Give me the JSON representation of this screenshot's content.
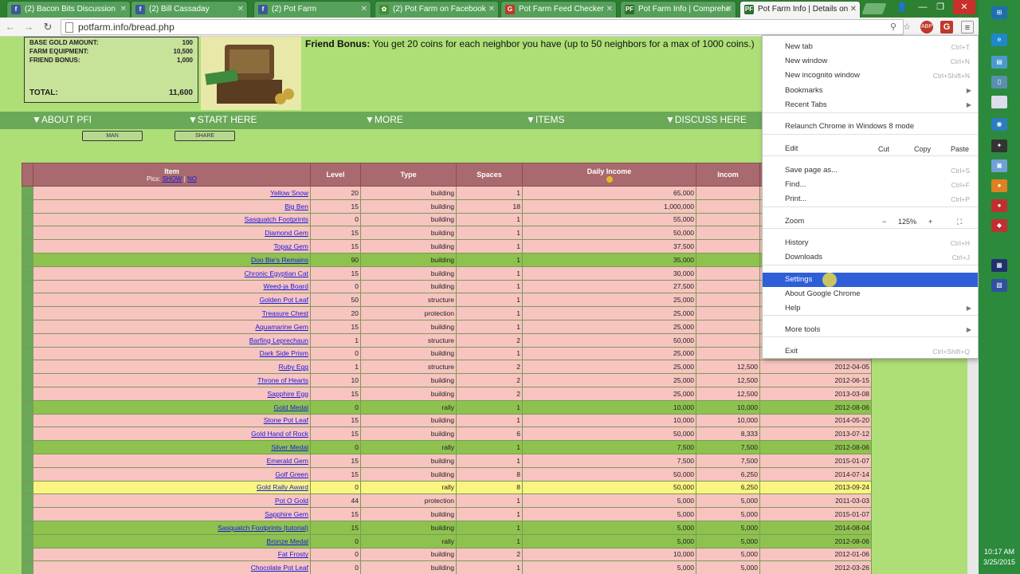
{
  "tabs": [
    {
      "label": "(2) Bacon Bits Discussion",
      "icon": "facebook-icon",
      "color": "#3b5998",
      "glyph": "f"
    },
    {
      "label": "(2) Bill Cassaday",
      "icon": "facebook-icon",
      "color": "#3b5998",
      "glyph": "f"
    },
    {
      "label": "(2) Pot Farm",
      "icon": "facebook-icon",
      "color": "#3b5998",
      "glyph": "f"
    },
    {
      "label": "(2) Pot Farm on Facebook",
      "icon": "leaf-icon",
      "color": "#3f8f2f",
      "glyph": "✿"
    },
    {
      "label": "Pot Farm Feed Checker",
      "icon": "g-icon",
      "color": "#c0392b",
      "glyph": "G"
    },
    {
      "label": "Pot Farm Info | Comprehe",
      "icon": "pf-icon",
      "color": "#2d6e2d",
      "glyph": "PF"
    },
    {
      "label": "Pot Farm Info | Details on",
      "icon": "pf-icon",
      "color": "#2d6e2d",
      "glyph": "PF",
      "active": true
    }
  ],
  "url": "potfarm.info/bread.php",
  "summary": {
    "rows": [
      {
        "label": "BASE GOLD AMOUNT:",
        "value": "100"
      },
      {
        "label": "FARM EQUIPMENT:",
        "value": "10,500"
      },
      {
        "label": "FRIEND BONUS:",
        "value": "1,000"
      }
    ],
    "total_label": "TOTAL:",
    "total_value": "11,600"
  },
  "bonus": {
    "label": "Friend Bonus:",
    "text": " You get 20 coins for each neighbor you have (up to 50 neighbors for a max of 1000 coins.)"
  },
  "nav": [
    "▼ABOUT PFI",
    "▼START HERE",
    "▼MORE",
    "▼ITEMS",
    "▼DISCUSS HERE"
  ],
  "mini_buttons": [
    "MAN",
    "SHARE"
  ],
  "table": {
    "headers": {
      "item": "Item",
      "pics": "Pics:",
      "show": "SHOW",
      "no": "NO",
      "level": "Level",
      "type": "Type",
      "spaces": "Spaces",
      "daily": "Daily Income",
      "income": "Incom"
    },
    "rows": [
      {
        "item": "Yellow Snow",
        "level": "20",
        "type": "building",
        "spaces": "1",
        "daily": "65,000",
        "inc": "",
        "date": "",
        "color": "pink"
      },
      {
        "item": "Big Ben",
        "level": "15",
        "type": "building",
        "spaces": "18",
        "daily": "1,000,000",
        "inc": "",
        "date": "",
        "color": "pink"
      },
      {
        "item": "Sasquatch Footprints",
        "level": "0",
        "type": "building",
        "spaces": "1",
        "daily": "55,000",
        "inc": "",
        "date": "",
        "color": "pink"
      },
      {
        "item": "Diamond Gem",
        "level": "15",
        "type": "building",
        "spaces": "1",
        "daily": "50,000",
        "inc": "",
        "date": "",
        "color": "pink"
      },
      {
        "item": "Topaz Gem",
        "level": "15",
        "type": "building",
        "spaces": "1",
        "daily": "37,500",
        "inc": "",
        "date": "",
        "color": "pink"
      },
      {
        "item": "Doo Bie's Remains",
        "level": "90",
        "type": "building",
        "spaces": "1",
        "daily": "35,000",
        "inc": "",
        "date": "",
        "color": "green"
      },
      {
        "item": "Chronic Egyptian Cat",
        "level": "15",
        "type": "building",
        "spaces": "1",
        "daily": "30,000",
        "inc": "",
        "date": "",
        "color": "pink"
      },
      {
        "item": "Weed-ja Board",
        "level": "0",
        "type": "building",
        "spaces": "1",
        "daily": "27,500",
        "inc": "",
        "date": "",
        "color": "pink"
      },
      {
        "item": "Golden Pot Leaf",
        "level": "50",
        "type": "structure",
        "spaces": "1",
        "daily": "25,000",
        "inc": "",
        "date": "",
        "color": "pink"
      },
      {
        "item": "Treasure Chest",
        "level": "20",
        "type": "protection",
        "spaces": "1",
        "daily": "25,000",
        "inc": "",
        "date": "",
        "color": "pink"
      },
      {
        "item": "Aquamarine Gem",
        "level": "15",
        "type": "building",
        "spaces": "1",
        "daily": "25,000",
        "inc": "",
        "date": "",
        "color": "pink"
      },
      {
        "item": "Barfing Leprechaun",
        "level": "1",
        "type": "structure",
        "spaces": "2",
        "daily": "50,000",
        "inc": "",
        "date": "",
        "color": "pink"
      },
      {
        "item": "Dark Side Prism",
        "level": "0",
        "type": "building",
        "spaces": "1",
        "daily": "25,000",
        "inc": "",
        "date": "",
        "color": "pink"
      },
      {
        "item": "Ruby Egg",
        "level": "1",
        "type": "structure",
        "spaces": "2",
        "daily": "25,000",
        "inc": "12,500",
        "date": "2012-04-05",
        "color": "pink"
      },
      {
        "item": "Throne of Hearts",
        "level": "10",
        "type": "building",
        "spaces": "2",
        "daily": "25,000",
        "inc": "12,500",
        "date": "2012-06-15",
        "color": "pink"
      },
      {
        "item": "Sapphire Egg",
        "level": "15",
        "type": "building",
        "spaces": "2",
        "daily": "25,000",
        "inc": "12,500",
        "date": "2013-03-08",
        "color": "pink"
      },
      {
        "item": "Gold Medal",
        "level": "0",
        "type": "rally",
        "spaces": "1",
        "daily": "10,000",
        "inc": "10,000",
        "date": "2012-08-06",
        "color": "green"
      },
      {
        "item": "Stone Pot Leaf",
        "level": "15",
        "type": "building",
        "spaces": "1",
        "daily": "10,000",
        "inc": "10,000",
        "date": "2014-05-20",
        "color": "pink"
      },
      {
        "item": "Gold Hand of Rock",
        "level": "15",
        "type": "building",
        "spaces": "6",
        "daily": "50,000",
        "inc": "8,333",
        "date": "2013-07-12",
        "color": "pink"
      },
      {
        "item": "Silver Medal",
        "level": "0",
        "type": "rally",
        "spaces": "1",
        "daily": "7,500",
        "inc": "7,500",
        "date": "2012-08-06",
        "color": "green"
      },
      {
        "item": "Emerald Gem",
        "level": "15",
        "type": "building",
        "spaces": "1",
        "daily": "7,500",
        "inc": "7,500",
        "date": "2015-01-07",
        "color": "pink"
      },
      {
        "item": "Golf Green",
        "level": "15",
        "type": "building",
        "spaces": "8",
        "daily": "50,000",
        "inc": "6,250",
        "date": "2014-07-14",
        "color": "pink"
      },
      {
        "item": "Gold Rally Award",
        "level": "0",
        "type": "rally",
        "spaces": "8",
        "daily": "50,000",
        "inc": "6,250",
        "date": "2013-09-24",
        "color": "yellow"
      },
      {
        "item": "Pot O Gold",
        "level": "44",
        "type": "protection",
        "spaces": "1",
        "daily": "5,000",
        "inc": "5,000",
        "date": "2011-03-03",
        "color": "pink"
      },
      {
        "item": "Sapphire Gem",
        "level": "15",
        "type": "building",
        "spaces": "1",
        "daily": "5,000",
        "inc": "5,000",
        "date": "2015-01-07",
        "color": "pink"
      },
      {
        "item": "Sasquatch Footprints (tutorial)",
        "level": "15",
        "type": "building",
        "spaces": "1",
        "daily": "5,000",
        "inc": "5,000",
        "date": "2014-08-04",
        "color": "green"
      },
      {
        "item": "Bronze Medal",
        "level": "0",
        "type": "rally",
        "spaces": "1",
        "daily": "5,000",
        "inc": "5,000",
        "date": "2012-08-06",
        "color": "green"
      },
      {
        "item": "Fat Frosty",
        "level": "0",
        "type": "building",
        "spaces": "2",
        "daily": "10,000",
        "inc": "5,000",
        "date": "2012-01-06",
        "color": "pink"
      },
      {
        "item": "Chocolate Pot Leaf",
        "level": "0",
        "type": "building",
        "spaces": "1",
        "daily": "5,000",
        "inc": "5,000",
        "date": "2012-03-26",
        "color": "pink"
      }
    ]
  },
  "menu": {
    "items": [
      {
        "label": "New tab",
        "shortcut": "Ctrl+T"
      },
      {
        "label": "New window",
        "shortcut": "Ctrl+N"
      },
      {
        "label": "New incognito window",
        "shortcut": "Ctrl+Shift+N"
      },
      {
        "label": "Bookmarks",
        "shortcut": "",
        "arrow": true
      },
      {
        "label": "Recent Tabs",
        "shortcut": "",
        "arrow": true
      },
      {
        "label": "Relaunch Chrome in Windows 8 mode",
        "shortcut": ""
      },
      {
        "label": "Edit",
        "shortcut": ""
      },
      {
        "label": "Save page as...",
        "shortcut": "Ctrl+S"
      },
      {
        "label": "Find...",
        "shortcut": "Ctrl+F"
      },
      {
        "label": "Print...",
        "shortcut": "Ctrl+P"
      },
      {
        "label": "Zoom",
        "shortcut": ""
      },
      {
        "label": "History",
        "shortcut": "Ctrl+H"
      },
      {
        "label": "Downloads",
        "shortcut": "Ctrl+J"
      },
      {
        "label": "Settings",
        "shortcut": "",
        "selected": true
      },
      {
        "label": "About Google Chrome",
        "shortcut": ""
      },
      {
        "label": "Help",
        "shortcut": "",
        "arrow": true
      },
      {
        "label": "More tools",
        "shortcut": "",
        "arrow": true
      },
      {
        "label": "Exit",
        "shortcut": "Ctrl+Shift+Q"
      }
    ],
    "edit_buttons": [
      "Cut",
      "Copy",
      "Paste"
    ],
    "zoom_minus": "−",
    "zoom_level": "125%",
    "zoom_plus": "+"
  },
  "clock": {
    "time": "10:17 AM",
    "date": "3/25/2015"
  }
}
